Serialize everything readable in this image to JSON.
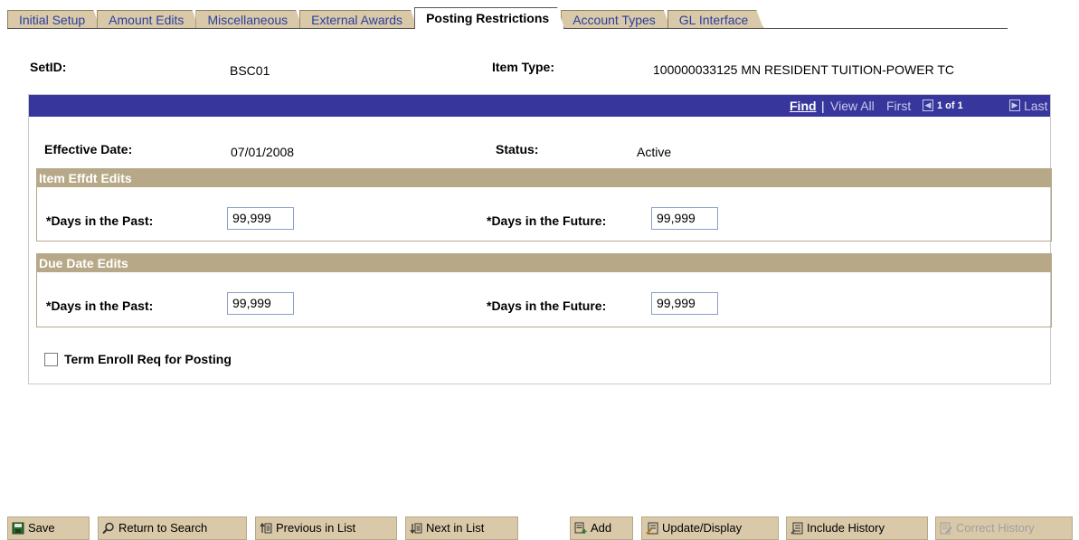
{
  "tabs": [
    {
      "label": "Initial Setup",
      "active": false
    },
    {
      "label": "Amount Edits",
      "active": false
    },
    {
      "label": "Miscellaneous",
      "active": false
    },
    {
      "label": "External Awards",
      "active": false
    },
    {
      "label": "Posting Restrictions",
      "active": true
    },
    {
      "label": "Account Types",
      "active": false
    },
    {
      "label": "GL Interface",
      "active": false
    }
  ],
  "header": {
    "setid_label": "SetID:",
    "setid_value": "BSC01",
    "item_type_label": "Item Type:",
    "item_type_value": "100000033125  MN RESIDENT TUITION-POWER TC"
  },
  "nav": {
    "find": "Find",
    "separator": "|",
    "view_all": "View All",
    "first": "First",
    "count": "1 of 1",
    "last": "Last"
  },
  "record": {
    "effective_date_label": "Effective Date:",
    "effective_date_value": "07/01/2008",
    "status_label": "Status:",
    "status_value": "Active"
  },
  "item_effdt_edits": {
    "title": "Item Effdt Edits",
    "past_label": "*Days in the Past:",
    "past_value": "99,999",
    "future_label": "*Days in the Future:",
    "future_value": "99,999"
  },
  "due_date_edits": {
    "title": "Due Date Edits",
    "past_label": "*Days in the Past:",
    "past_value": "99,999",
    "future_label": "*Days in the Future:",
    "future_value": "99,999"
  },
  "term_enroll": {
    "label": "Term Enroll Req for Posting",
    "checked": false
  },
  "toolbar": {
    "save": "Save",
    "return_to_search": "Return to Search",
    "previous_in_list": "Previous in List",
    "next_in_list": "Next in List",
    "add": "Add",
    "update_display": "Update/Display",
    "include_history": "Include History",
    "correct_history": "Correct History"
  },
  "colors": {
    "tab_bg": "#d9c9a8",
    "tab_text": "#2a3f9f",
    "nav_bar": "#37369d",
    "group_header": "#b7a987"
  }
}
